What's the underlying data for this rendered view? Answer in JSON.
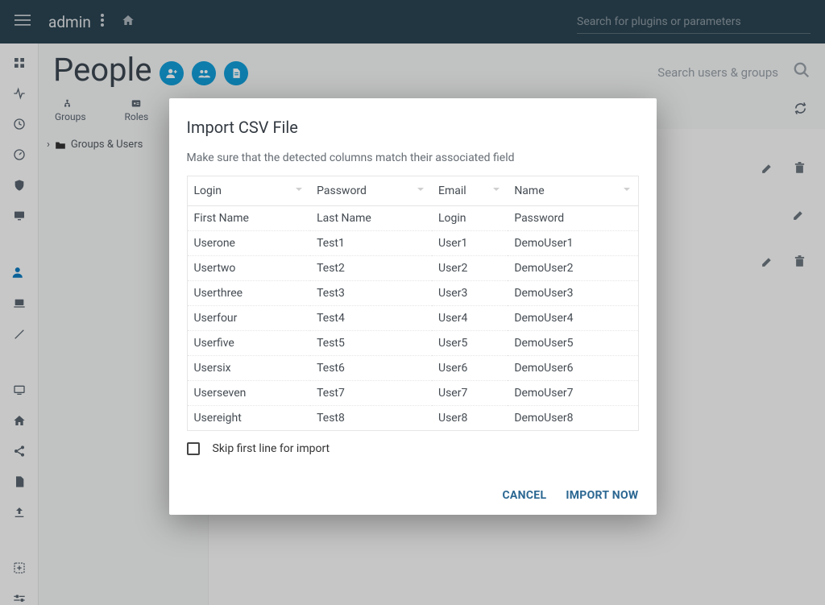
{
  "topbar": {
    "username": "admin",
    "search_placeholder": "Search for plugins or parameters"
  },
  "page": {
    "title": "People",
    "search_placeholder": "Search users & groups"
  },
  "subnav": {
    "groups": "Groups",
    "roles": "Roles"
  },
  "tree": {
    "root": "Groups & Users"
  },
  "dialog": {
    "title": "Import CSV File",
    "subtitle": "Make sure that the detected columns match their associated field",
    "columns": [
      "Login",
      "Password",
      "Email",
      "Name"
    ],
    "rows": [
      [
        "First Name",
        "Last Name",
        "Login",
        "Password"
      ],
      [
        "Userone",
        "Test1",
        "User1",
        "DemoUser1"
      ],
      [
        "Usertwo",
        "Test2",
        "User2",
        "DemoUser2"
      ],
      [
        "Userthree",
        "Test3",
        "User3",
        "DemoUser3"
      ],
      [
        "Userfour",
        "Test4",
        "User4",
        "DemoUser4"
      ],
      [
        "Userfive",
        "Test5",
        "User5",
        "DemoUser5"
      ],
      [
        "Usersix",
        "Test6",
        "User6",
        "DemoUser6"
      ],
      [
        "Userseven",
        "Test7",
        "User7",
        "DemoUser7"
      ],
      [
        "Usereight",
        "Test8",
        "User8",
        "DemoUser8"
      ]
    ],
    "skip_label": "Skip first line for import",
    "cancel": "CANCEL",
    "import": "IMPORT NOW"
  }
}
